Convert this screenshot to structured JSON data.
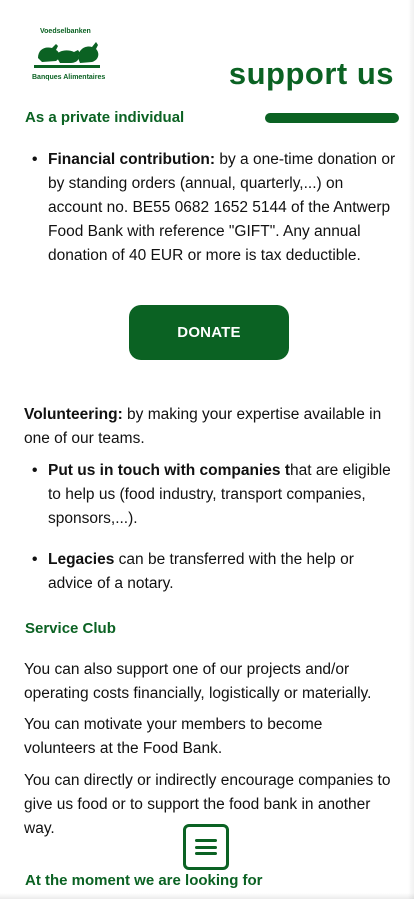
{
  "header": {
    "logo_top_text": "Voedselbanken",
    "logo_bottom_text": "Banques Alimentaires",
    "page_title": "support us"
  },
  "colors": {
    "brand_green": "#0b6223",
    "text": "#111111",
    "background": "#ffffff"
  },
  "section_private": {
    "heading": "As a private individual",
    "bullet_financial": {
      "label": "Financial contribution:",
      "text": " by a one-time donation or by standing orders (annual, quarterly,...) on account no. BE55 0682 1652 5144 of the Antwerp Food Bank with reference \"GIFT\". Any annual donation of 40 EUR or more is tax deductible."
    },
    "donate_label": "DONATE",
    "volunteering": {
      "label": "Volunteering:",
      "text": " by making your expertise available in one of our teams."
    },
    "bullet_companies": {
      "label": "Put us in touch with companies t",
      "text": "hat are eligible to help us (food industry, transport companies, sponsors,...)."
    },
    "bullet_legacies": {
      "label": "Legacies",
      "text": " can be transferred with the help or advice of a notary."
    }
  },
  "section_service": {
    "heading": "Service Club",
    "paragraphs": [
      "You can also support one of our projects and/or operating costs financially, logistically or materially.",
      "You can motivate your members to become volunteers at the Food Bank.",
      "You can directly or indirectly encourage companies to give us food or to support the food bank in another way."
    ]
  },
  "section_moment": {
    "heading": "At the moment we are looking for"
  },
  "icons": {
    "menu": "hamburger-menu-icon",
    "logo": "food-bank-animals-logo"
  }
}
